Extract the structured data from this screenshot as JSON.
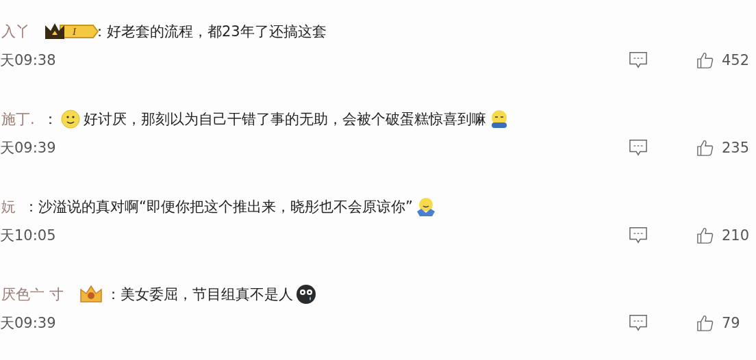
{
  "comments": [
    {
      "user": "入丫",
      "badge": {
        "kind": "crown-level",
        "text": "I"
      },
      "parts": [
        {
          "kind": "text",
          "text": "：好老套的流程，都23年了还搞这套"
        }
      ],
      "time": "天09:38",
      "likes": "452"
    },
    {
      "user": "施丁.",
      "parts": [
        {
          "kind": "text",
          "text": "："
        },
        {
          "kind": "smile"
        },
        {
          "kind": "text",
          "text": "好讨厌，那刻以为自己干错了事的无助，会被个破蛋糕惊喜到嘛"
        },
        {
          "kind": "hug"
        }
      ],
      "time": "天09:39",
      "likes": "235"
    },
    {
      "user": "妧",
      "parts": [
        {
          "kind": "text",
          "text": "：沙溢说的真对啊“即便你把这个推出来，晓彤也不会原谅你”"
        },
        {
          "kind": "shrug"
        }
      ],
      "time": "天10:05",
      "likes": "210"
    },
    {
      "user": "厌色亠 寸",
      "badge": {
        "kind": "gold-crown"
      },
      "parts": [
        {
          "kind": "text",
          "text": "：美女委屈，节目组真不是人"
        },
        {
          "kind": "cry"
        }
      ],
      "time": "天09:39",
      "likes": "79"
    }
  ]
}
